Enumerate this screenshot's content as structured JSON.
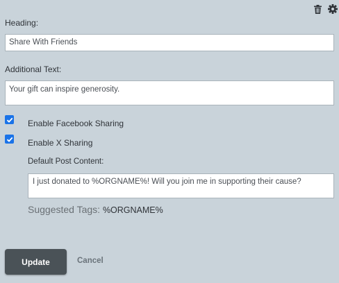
{
  "icons": {
    "delete": "trash-icon",
    "settings": "gear-icon"
  },
  "heading": {
    "label": "Heading:",
    "value": "Share With Friends"
  },
  "additional_text": {
    "label": "Additional Text:",
    "value": "Your gift can inspire generosity."
  },
  "facebook": {
    "label": "Enable Facebook Sharing",
    "checked": true
  },
  "x_sharing": {
    "label": "Enable X Sharing",
    "checked": true
  },
  "post": {
    "label": "Default Post Content:",
    "value": "I just donated to %ORGNAME%! Will you join me in supporting their cause?"
  },
  "tags": {
    "label": "Suggested Tags:",
    "value": "%ORGNAME%"
  },
  "buttons": {
    "update": "Update",
    "cancel": "Cancel"
  },
  "colors": {
    "background": "#c9d3da",
    "checkbox": "#1a73e8",
    "primary_button": "#4a5257"
  }
}
